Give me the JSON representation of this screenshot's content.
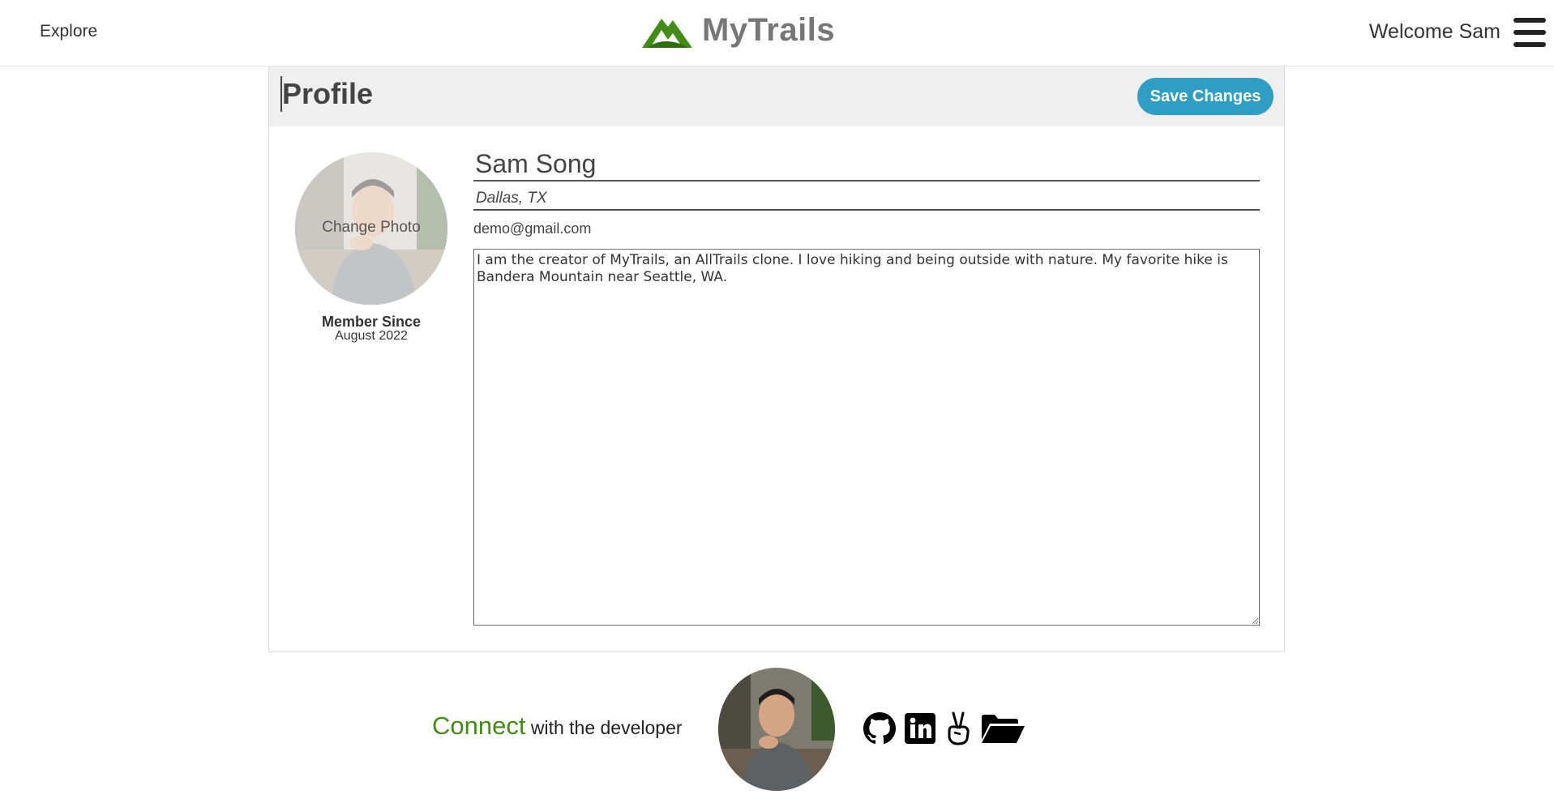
{
  "header": {
    "explore": "Explore",
    "brand": "MyTrails",
    "welcome": "Welcome Sam"
  },
  "profile": {
    "title": "Profile",
    "save_label": "Save Changes",
    "change_photo": "Change Photo",
    "member_since_label": "Member Since",
    "member_since_date": "August 2022",
    "name": "Sam Song",
    "location": "Dallas, TX",
    "email": "demo@gmail.com",
    "bio": "I am the creator of MyTrails, an AllTrails clone. I love hiking and being outside with nature. My favorite hike is Bandera Mountain near Seattle, WA."
  },
  "footer": {
    "connect": "Connect",
    "with_dev": "with the developer",
    "icons": [
      "github-icon",
      "linkedin-icon",
      "angellist-icon",
      "folder-icon"
    ]
  },
  "colors": {
    "brand_green": "#438c17",
    "save_button": "#2e9ec2",
    "header_band": "#efefef"
  }
}
